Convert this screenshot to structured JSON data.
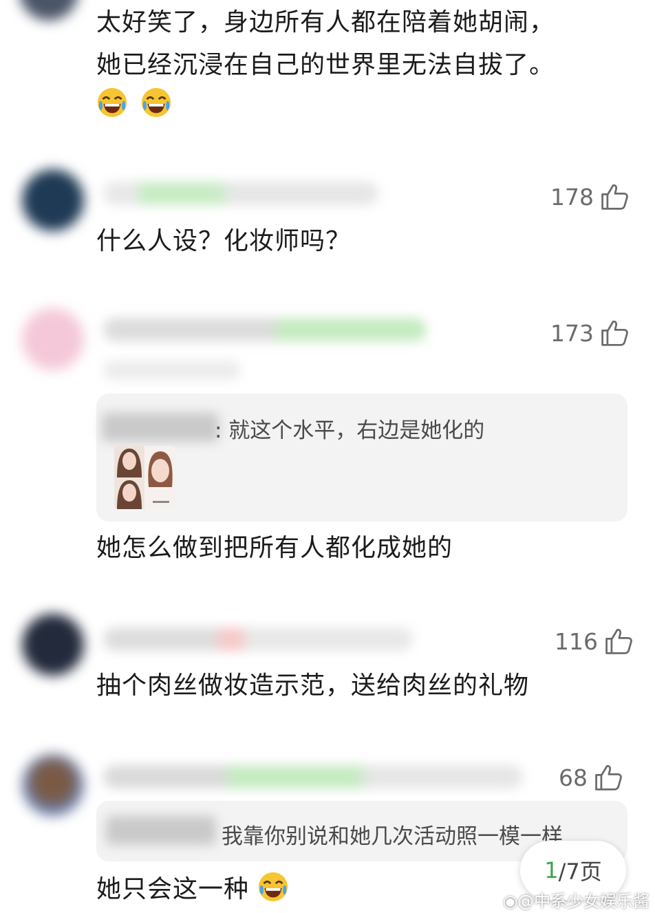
{
  "top_comment": {
    "lines": [
      "太好笑了，身边所有人都在陪着她胡闹，",
      "她已经沉浸在自己的世界里无法自拔了。"
    ],
    "emoji": [
      "laughing-tears",
      "laughing-tears"
    ]
  },
  "comments": [
    {
      "likes": "178",
      "text": "什么人设？化妆师吗？"
    },
    {
      "likes": "173",
      "reply_text": ": 就这个水平，右边是她化的",
      "text": "她怎么做到把所有人都化成她的"
    },
    {
      "likes": "116",
      "text": "抽个肉丝做妆造示范，送给肉丝的礼物"
    },
    {
      "likes": "68",
      "reply_text": "我靠你别说和她几次活动照一模一样",
      "text": "她只会这一种"
    }
  ],
  "pagination": {
    "current": "1",
    "total_label": "/7页"
  },
  "watermark": "@中系少女娱乐酱",
  "colors": {
    "accent_green": "#3aa64a",
    "reply_bg": "#f3f3f3",
    "like_gray": "#6b6b6b"
  },
  "icons": {
    "like": "thumbs-up-outline-icon",
    "emoji": "face-with-tears-of-joy"
  }
}
